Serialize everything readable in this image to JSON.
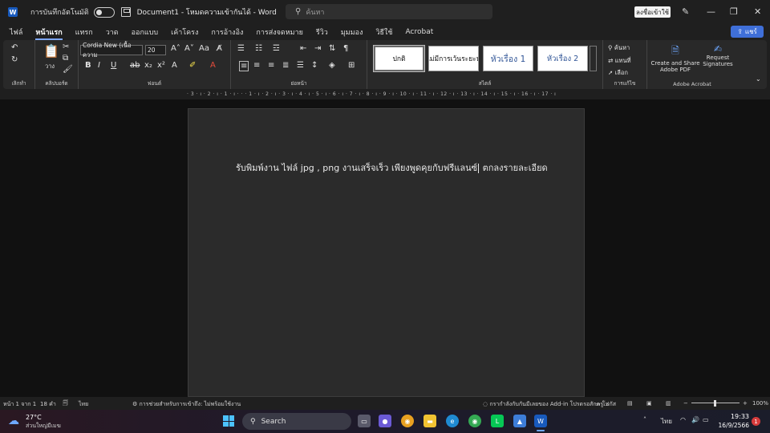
{
  "titlebar": {
    "autosave_label": "การบันทึกอัตโนมัติ",
    "doc_title": "Document1 - โหมดความเข้ากันได้ - Word",
    "search_placeholder": "ค้นหา",
    "signin_label": "ลงชื่อเข้าใช้"
  },
  "tabs": [
    "ไฟล์",
    "หน้าแรก",
    "แทรก",
    "วาด",
    "ออกแบบ",
    "เค้าโครง",
    "การอ้างอิง",
    "การส่งจดหมาย",
    "รีวิว",
    "มุมมอง",
    "วิธีใช้",
    "Acrobat"
  ],
  "active_tab": "หน้าแรก",
  "share_label": "แชร์",
  "ribbon": {
    "undo_label": "เลิกทำ",
    "clipboard_label": "คลิปบอร์ด",
    "paste_label": "วาง",
    "font_label": "ฟอนต์",
    "font_name": "Cordia New (เนื้อความ",
    "font_size": "20",
    "paragraph_label": "ย่อหน้า",
    "styles_label": "สไตล์",
    "styles": [
      "ปกติ",
      "ไม่มีการเว้นระยะห่",
      "หัวเรื่อง 1",
      "หัวเรื่อง 2"
    ],
    "editing_label": "การแก้ไข",
    "find_label": "ค้นหา",
    "replace_label": "แทนที่",
    "select_label": "เลือก",
    "acrobat_label": "Adobe Acrobat",
    "create_share_label_1": "Create and Share",
    "create_share_label_2": "Adobe PDF",
    "request_sig_label_1": "Request",
    "request_sig_label_2": "Signatures"
  },
  "ruler_text": "· 3 · ı · 2 · ı · 1 · ı · · · 1 · ı · 2 · ı · 3 · ı · 4 · ı · 5 · ı · 6 · ı · 7 · ı · 8 · ı · 9 · ı · 10 · ı · 11 · ı · 12 · ı · 13 · ı · 14 · ı · 15 · ı · 16 · ı · 17 · ı",
  "document": {
    "text_before_cursor": "รับพิมพ์งาน ไฟล์ jpg , png งานเสร็จเร็ว เพียงพูดคุยกับฟรีแลนซ์",
    "text_after_cursor": " ตกลงรายละเอียด"
  },
  "statusbar": {
    "page": "หน้า 1 จาก 1",
    "words": "18 คำ",
    "language": "ไทย",
    "accessibility": "การช่วยสำหรับการเข้าถึง: ไม่พร้อมใช้งาน",
    "addin_message": "กรากำลังกับกันมีเลยของ Add-in โปรดรอสักครู่...",
    "focus": "โฟกัส",
    "zoom": "100%"
  },
  "taskbar": {
    "temperature": "27°C",
    "weather": "ส่วนใหญ่มีเมฆ",
    "search_label": "Search",
    "language": "ไทย",
    "time": "19:33",
    "date": "16/9/2566",
    "notification_count": "1"
  }
}
